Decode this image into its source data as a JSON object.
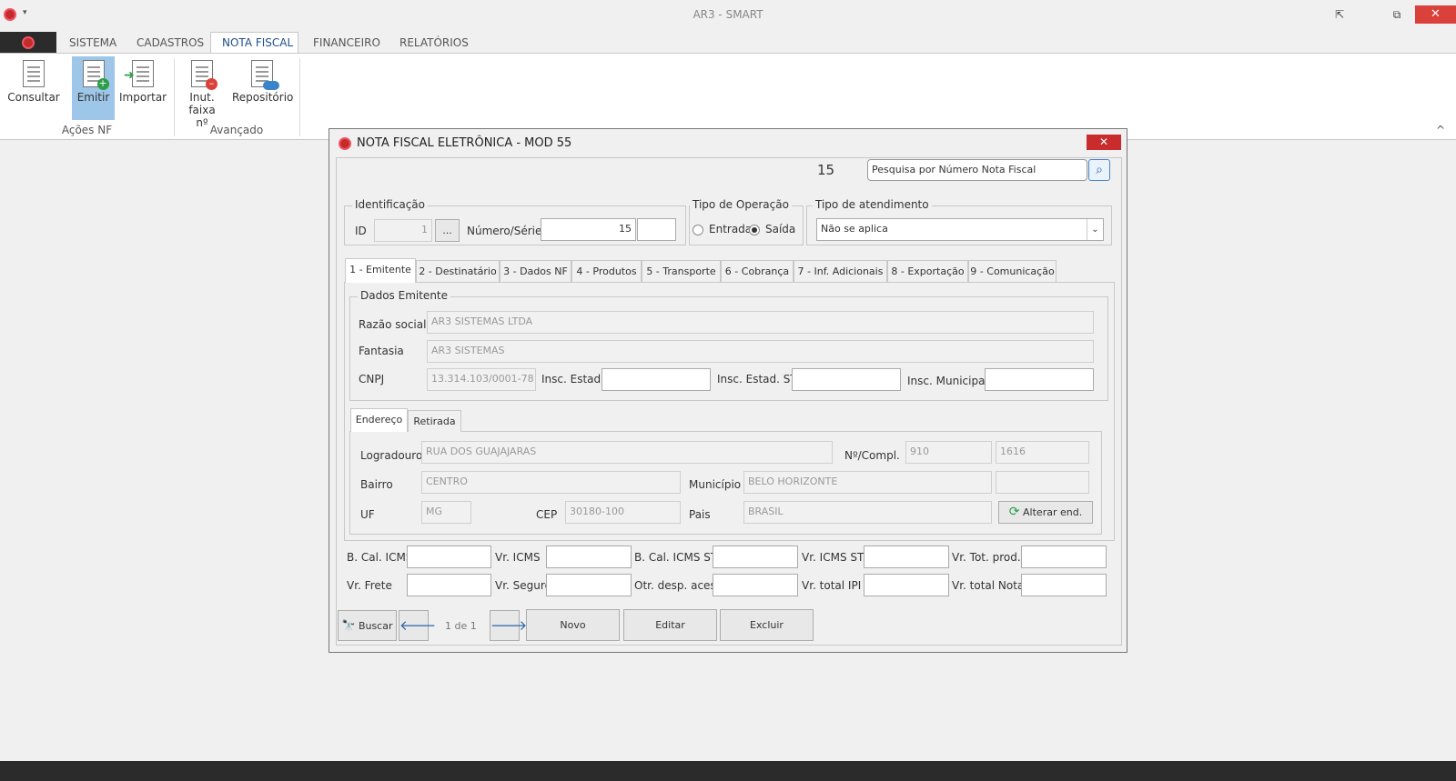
{
  "app": {
    "title": "AR3 - SMART"
  },
  "window_controls": {
    "pin": "⇱",
    "restore": "⧉",
    "minimize": "–",
    "close": "✕"
  },
  "menu": {
    "items": [
      "SISTEMA",
      "CADASTROS",
      "NOTA FISCAL",
      "FINANCEIRO",
      "RELATÓRIOS"
    ],
    "active": "NOTA FISCAL"
  },
  "ribbon": {
    "buttons": [
      {
        "label": "Consultar",
        "icon": "consult-document-icon"
      },
      {
        "label": "Emitir",
        "icon": "emit-document-icon"
      },
      {
        "label": "Importar",
        "icon": "import-document-icon"
      },
      {
        "label": "Inut.",
        "label2": "faixa nº",
        "icon": "cancel-document-icon"
      },
      {
        "label": "Repositório",
        "icon": "cloud-document-icon"
      }
    ],
    "groups": [
      "Ações NF",
      "Avançado"
    ],
    "collapse": "^"
  },
  "dialog": {
    "title": "NOTA FISCAL ELETRÔNICA - MOD 55",
    "close": "✕",
    "number_display": "15",
    "search_placeholder": "Pesquisa por Número Nota Fiscal",
    "identificacao": {
      "legend": "Identificação",
      "id_label": "ID",
      "id_value": "1",
      "ellipsis": "...",
      "numero_label": "Número/Série",
      "numero_value": "15",
      "serie_value": ""
    },
    "tipo_operacao": {
      "legend": "Tipo de Operação",
      "entrada": "Entrada",
      "saida": "Saída",
      "selected": "Saída"
    },
    "tipo_atendimento": {
      "legend": "Tipo de atendimento",
      "value": "Não se aplica"
    },
    "tabs": [
      "1 - Emitente",
      "2 - Destinatário",
      "3 - Dados NF",
      "4 - Produtos",
      "5 - Transporte",
      "6 - Cobrança",
      "7 - Inf. Adicionais",
      "8 - Exportação",
      "9 - Comunicação"
    ],
    "emitente": {
      "legend": "Dados Emitente",
      "razao_label": "Razão social",
      "razao_value": "AR3 SISTEMAS LTDA",
      "fantasia_label": "Fantasia",
      "fantasia_value": "AR3 SISTEMAS",
      "cnpj_label": "CNPJ",
      "cnpj_value": "13.314.103/0001-78",
      "ie_label": "Insc. Estad.",
      "iest_label": "Insc. Estad. ST",
      "im_label": "Insc. Municipal"
    },
    "subtabs": [
      "Endereço",
      "Retirada"
    ],
    "endereco": {
      "logradouro_label": "Logradouro",
      "logradouro_value": "RUA DOS GUAJAJARAS",
      "num_label": "Nº/Compl.",
      "num_value": "910",
      "compl_value": "1616",
      "bairro_label": "Bairro",
      "bairro_value": "CENTRO",
      "municipio_label": "Município",
      "municipio_value": "BELO HORIZONTE",
      "uf_label": "UF",
      "uf_value": "MG",
      "cep_label": "CEP",
      "cep_value": "30180-100",
      "pais_label": "Pais",
      "pais_value": "BRASIL",
      "alterar": "Alterar end."
    },
    "totais": {
      "bcicms": "B. Cal. ICMS",
      "vricms": "Vr. ICMS",
      "bcicmsst": "B. Cal. ICMS ST",
      "vricmsst": "Vr. ICMS ST",
      "vrtotprod": "Vr. Tot. prod.",
      "vrfrete": "Vr. Frete",
      "vrseguro": "Vr. Seguro",
      "otrdesp": "Otr. desp. acess",
      "vrtotalipi": "Vr. total IPI",
      "vrtotalnota": "Vr. total Nota"
    },
    "footer": {
      "buscar": "Buscar",
      "prev": "🡐",
      "pager": "1 de 1",
      "next": "🡒",
      "novo": "Novo",
      "editar": "Editar",
      "excluir": "Excluir"
    }
  },
  "colors": {
    "accent": "#c62b2b",
    "ribbon_selected": "#9dc6e8",
    "close_red": "#d9413a"
  }
}
